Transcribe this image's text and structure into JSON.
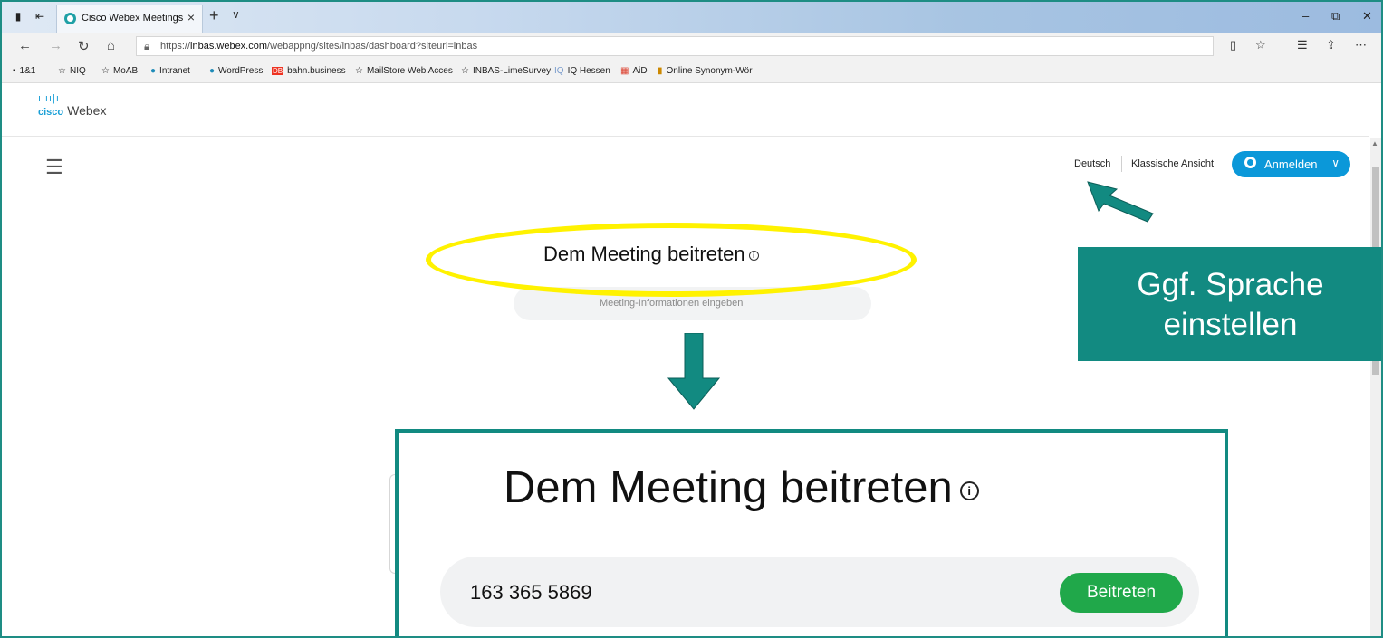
{
  "browser": {
    "tab_title": "Cisco Webex Meetings",
    "tab_close": "×",
    "new_tab": "+",
    "tab_menu": "∨",
    "win_min": "–",
    "win_max": "⧉",
    "win_close": "✕",
    "back": "←",
    "forward": "→",
    "refresh": "↻",
    "home": "⌂",
    "url_prefix": "https://",
    "url_host": "inbas.webex.com",
    "url_path": "/webappng/sites/inbas/dashboard?siteurl=inbas",
    "bookmarks": [
      {
        "label": "1&1",
        "icon": "▪"
      },
      {
        "label": "NIQ",
        "icon": "☆"
      },
      {
        "label": "MoAB",
        "icon": "☆"
      },
      {
        "label": "Intranet",
        "icon": "●"
      },
      {
        "label": "WordPress",
        "icon": "●"
      },
      {
        "label": "bahn.business",
        "icon": "DB"
      },
      {
        "label": "MailStore Web Acces",
        "icon": "☆"
      },
      {
        "label": "INBAS-LimeSurvey",
        "icon": "☆"
      },
      {
        "label": "IQ Hessen",
        "icon": "IQ"
      },
      {
        "label": "AiD",
        "icon": "▦"
      },
      {
        "label": "Online Synonym-Wör",
        "icon": "▮"
      }
    ]
  },
  "header": {
    "logo_text": "cisco",
    "logo_product": "Webex",
    "language": "Deutsch",
    "classic_view": "Klassische Ansicht",
    "sign_in": "Anmelden"
  },
  "main": {
    "join_title": "Dem Meeting beitreten",
    "input_placeholder": "Meeting-Informationen eingeben"
  },
  "callout": {
    "line1": "Ggf. Sprache",
    "line2": "einstellen"
  },
  "zoom": {
    "title": "Dem Meeting beitreten",
    "meeting_number": "163 365 5869",
    "join_button": "Beitreten"
  },
  "colors": {
    "accent_teal": "#128a81",
    "highlight_yellow": "#fff200",
    "signin_blue": "#0b98d9",
    "join_green": "#20a84a"
  }
}
